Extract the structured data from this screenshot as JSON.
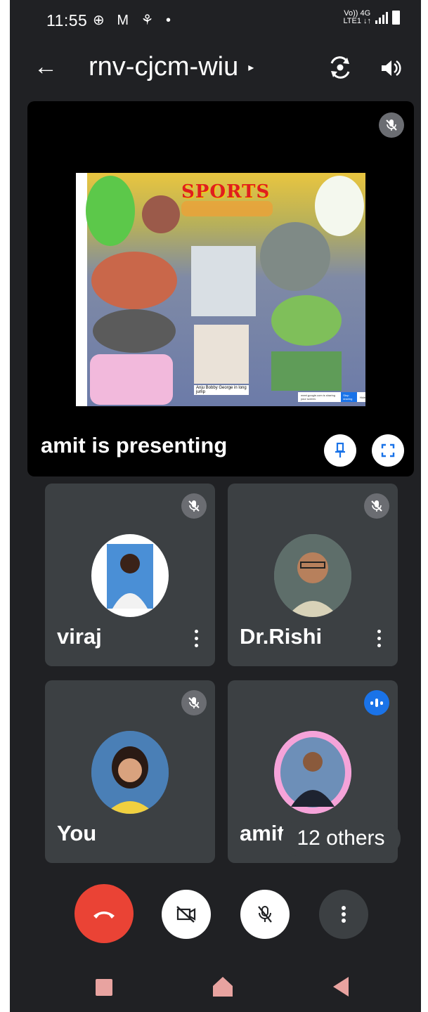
{
  "status_bar": {
    "time": "11:55",
    "notification_icons": "⊕ M ⚘ •",
    "network_top": "Vo)) 4G",
    "network_bottom": "LTE1 ↓↑"
  },
  "header": {
    "meeting_code": "rnv-cjcm-wiu",
    "caret": "▸"
  },
  "presentation": {
    "label": "amit is presenting",
    "slide_title": "SPORTS",
    "slide_caption": "Anju Bobby George in long jump",
    "share_notice": "meet.google.com is sharing your screen.",
    "stop_sharing": "Stop sharing",
    "hide": "Hide"
  },
  "participants": [
    {
      "name": "viraj",
      "status": "muted"
    },
    {
      "name": "Dr.Rishi",
      "status": "muted"
    },
    {
      "name": "You",
      "status": "muted"
    },
    {
      "name": "amit",
      "status": "speaking"
    }
  ],
  "others_count_label": "12 others",
  "colors": {
    "background": "#202124",
    "tile": "#3c4043",
    "end_call": "#ea4335",
    "speaking": "#1a73e8",
    "pin_icon": "#1a73e8"
  },
  "icons": {
    "back": "arrow-left",
    "camera_switch": "camera-switch",
    "speaker": "speaker",
    "pin": "pin",
    "fullscreen": "fullscreen",
    "end_call": "phone-hangup",
    "camera": "video-off",
    "mic": "mic-off",
    "more": "more-vertical"
  }
}
